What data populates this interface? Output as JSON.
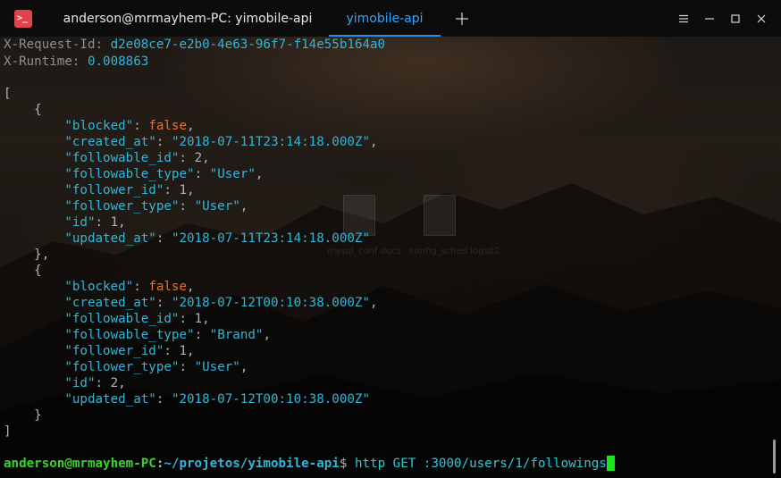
{
  "window": {
    "tabs": [
      {
        "label": "anderson@mrmayhem-PC: yimobile-api",
        "active": false
      },
      {
        "label": "yimobile-api",
        "active": true
      }
    ],
    "app_icon_glyph": ">_",
    "new_tab_glyph": "+",
    "controls": [
      "menu-icon",
      "minimize-icon",
      "maximize-icon",
      "close-icon"
    ],
    "accent": "#1f8fe8"
  },
  "terminal": {
    "headers": [
      {
        "name": "X-Request-Id",
        "value": "d2e08ce7-e2b0-4e63-96f7-f14e55b164a0"
      },
      {
        "name": "X-Runtime",
        "value": "0.008863"
      }
    ],
    "records": [
      {
        "blocked": "false",
        "created_at": "\"2018-07-11T23:14:18.000Z\"",
        "followable_id": "2",
        "followable_type": "\"User\"",
        "follower_id": "1",
        "follower_type": "\"User\"",
        "id": "1",
        "updated_at": "\"2018-07-11T23:14:18.000Z\""
      },
      {
        "blocked": "false",
        "created_at": "\"2018-07-12T00:10:38.000Z\"",
        "followable_id": "1",
        "followable_type": "\"Brand\"",
        "follower_id": "1",
        "follower_type": "\"User\"",
        "id": "2",
        "updated_at": "\"2018-07-12T00:10:38.000Z\""
      }
    ],
    "prompt": {
      "user_host": "anderson@mrmayhem-PC",
      "path": "~/projetos/yimobile-api",
      "symbol": "$",
      "command": "http GET :3000/users/1/followings"
    }
  },
  "desktop_icons": [
    {
      "label": "mysql_conf\ndocs"
    },
    {
      "label": "config_sched\nlogs02"
    }
  ],
  "colors": {
    "key": "#33b5d8",
    "boolean": "#e8742c",
    "prompt_user": "#3bd12c",
    "cursor": "#19e619"
  }
}
